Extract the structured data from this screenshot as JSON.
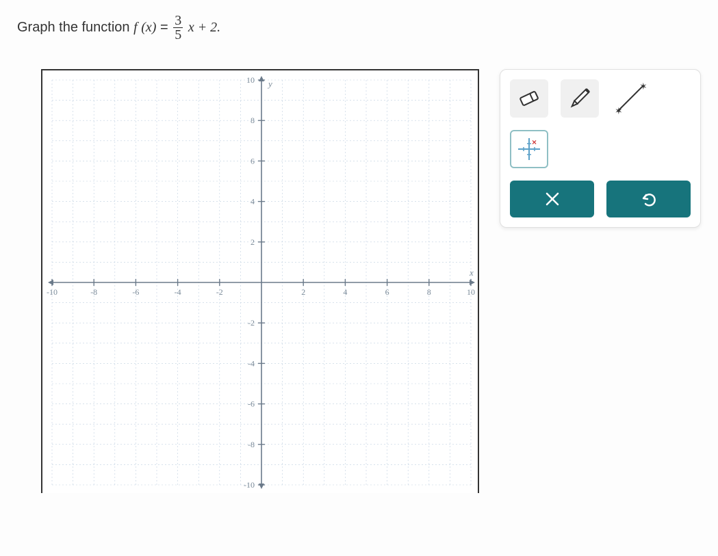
{
  "prompt": {
    "prefix": "Graph the function ",
    "func": "f",
    "arg": "(x)",
    "equals": " = ",
    "frac_num": "3",
    "frac_den": "5",
    "suffix": "x + 2."
  },
  "graph": {
    "xmin": -10,
    "xmax": 10,
    "ymin": -10,
    "ymax": 10,
    "xlabel": "x",
    "ylabel": "y",
    "x_ticks": [
      -10,
      -8,
      -6,
      -4,
      -2,
      2,
      4,
      6,
      8,
      10
    ],
    "y_ticks": [
      -10,
      -8,
      -6,
      -4,
      -2,
      2,
      4,
      6,
      8,
      10
    ]
  },
  "tools": {
    "eraser": "eraser-tool",
    "pencil": "pencil-tool",
    "line_segment": "line-segment-tool",
    "point_graph": "point-graph-tool"
  },
  "actions": {
    "clear": "Clear",
    "undo": "Undo"
  },
  "chart_data": {
    "type": "line",
    "title": "",
    "xlabel": "x",
    "ylabel": "y",
    "xlim": [
      -10,
      10
    ],
    "ylim": [
      -10,
      10
    ],
    "categories": [],
    "series": []
  }
}
